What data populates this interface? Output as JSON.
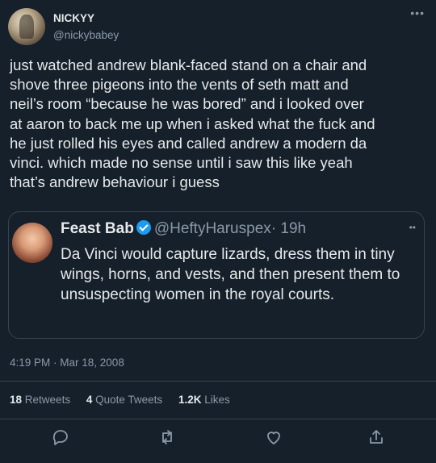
{
  "author": {
    "display_name": "NICKYY",
    "handle": "@nickybabey",
    "avatar": "user-avatar-photo"
  },
  "more_icon": "more-dots-icon",
  "tweet_text": "just watched andrew blank-faced stand on a chair and\nshove three pigeons into the vents of seth matt and\nneil’s room “because he was bored” and i looked over\nat aaron to back me up when i asked what the fuck and\nhe just rolled his eyes and called andrew a modern da\nvinci. which made no sense until i saw this like yeah\nthat’s andrew behaviour i guess",
  "quote": {
    "name": "Feast Bab",
    "handle": "@HeftyHaruspex",
    "time": "· 19h",
    "text": "Da Vinci would capture lizards, dress them in tiny wings, horns, and vests, and then present them to unsuspecting women in the royal courts.",
    "avatar": "cherub-painting-avatar",
    "verified_icon": "verified-badge-icon",
    "more_icon": "more-dots-icon"
  },
  "timestamp": "4:19 PM · Mar 18, 2008",
  "stats": {
    "retweets_count": "18",
    "retweets_label": "Retweets",
    "quotes_count": "4",
    "quotes_label": "Quote Tweets",
    "likes_count": "1.2K",
    "likes_label": "Likes"
  },
  "actions": [
    "reply-icon",
    "retweet-icon",
    "like-icon",
    "share-icon"
  ],
  "colors": {
    "background": "#15202b",
    "text": "#e7e9ea",
    "secondary": "#8b98a5",
    "border": "#38444d",
    "verified": "#1d9bf0"
  }
}
